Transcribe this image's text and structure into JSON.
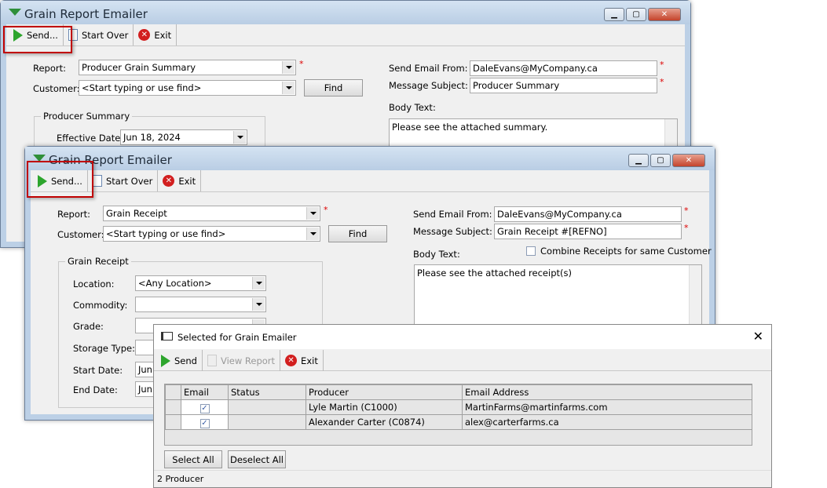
{
  "app_title": "Grain Report Emailer",
  "toolbar": {
    "send": "Send...",
    "start_over": "Start Over",
    "exit": "Exit"
  },
  "window1": {
    "report_label": "Report:",
    "report_value": "Producer Grain Summary",
    "customer_label": "Customer:",
    "customer_value": "<Start typing or use find>",
    "find": "Find",
    "group_title": "Producer Summary",
    "effective_date_label": "Effective Date:",
    "effective_date": "Jun  18, 2024",
    "from_label": "Send Email From:",
    "from_value": "DaleEvans@MyCompany.ca",
    "subject_label": "Message Subject:",
    "subject_value": "Producer Summary",
    "body_label": "Body Text:",
    "body_value": "Please see the attached summary."
  },
  "window2": {
    "report_label": "Report:",
    "report_value": "Grain Receipt",
    "customer_label": "Customer:",
    "customer_value": "<Start typing or use find>",
    "find": "Find",
    "group_title": "Grain Receipt",
    "location_label": "Location:",
    "location_value": "<Any Location>",
    "commodity_label": "Commodity:",
    "grade_label": "Grade:",
    "storage_label": "Storage Type:",
    "start_label": "Start Date:",
    "start_value": "Jun",
    "end_label": "End Date:",
    "end_value": "Jun",
    "from_label": "Send Email From:",
    "from_value": "DaleEvans@MyCompany.ca",
    "subject_label": "Message Subject:",
    "subject_value": "Grain Receipt #[REFNO]",
    "body_label": "Body Text:",
    "combine_label": "Combine Receipts for same Customer",
    "combine_checked": false,
    "body_value": "Please see the attached receipt(s)"
  },
  "dialog": {
    "title": "Selected for Grain Emailer",
    "toolbar": {
      "send": "Send",
      "view_report": "View Report",
      "exit": "Exit"
    },
    "columns": [
      "Email",
      "Status",
      "Producer",
      "Email Address"
    ],
    "rows": [
      {
        "email": true,
        "status": "",
        "producer": "Lyle Martin (C1000)",
        "address": "MartinFarms@martinfarms.com"
      },
      {
        "email": true,
        "status": "",
        "producer": "Alexander Carter (C0874)",
        "address": "alex@carterfarms.ca"
      }
    ],
    "select_all": "Select All",
    "deselect_all": "Deselect All",
    "status": "2 Producer"
  },
  "colors": {
    "highlight": "#c00000",
    "required": "#dd0000",
    "title_bar": "#bcd0e6"
  }
}
